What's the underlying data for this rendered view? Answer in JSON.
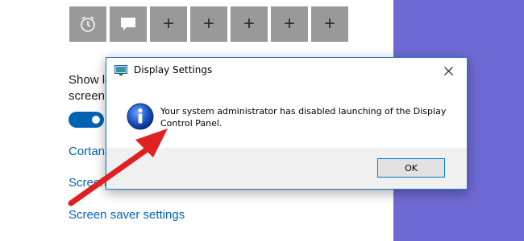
{
  "colors": {
    "accent_blue": "#0063b1",
    "purple_background": "#6e6ad4",
    "tile_gray": "#999999",
    "annotation_arrow_red": "#e02020"
  },
  "quick_actions": [
    {
      "icon": "alarm-clock-icon",
      "label": ""
    },
    {
      "icon": "message-icon",
      "label": ""
    },
    {
      "icon": "plus-icon",
      "label": "+"
    },
    {
      "icon": "plus-icon",
      "label": "+"
    },
    {
      "icon": "plus-icon",
      "label": "+"
    },
    {
      "icon": "plus-icon",
      "label": "+"
    },
    {
      "icon": "plus-icon",
      "label": "+"
    }
  ],
  "settings": {
    "show_label_line1": "Show lo",
    "show_label_line2": "screen",
    "toggle_state": "on",
    "links": {
      "cortana": "Cortana",
      "screen": "Screen",
      "screen_saver": "Screen saver settings"
    }
  },
  "dialog": {
    "title": "Display Settings",
    "message": "Your system administrator has disabled launching of the Display Control Panel.",
    "ok_label": "OK",
    "icon": "info-icon",
    "close_icon": "close-icon"
  }
}
